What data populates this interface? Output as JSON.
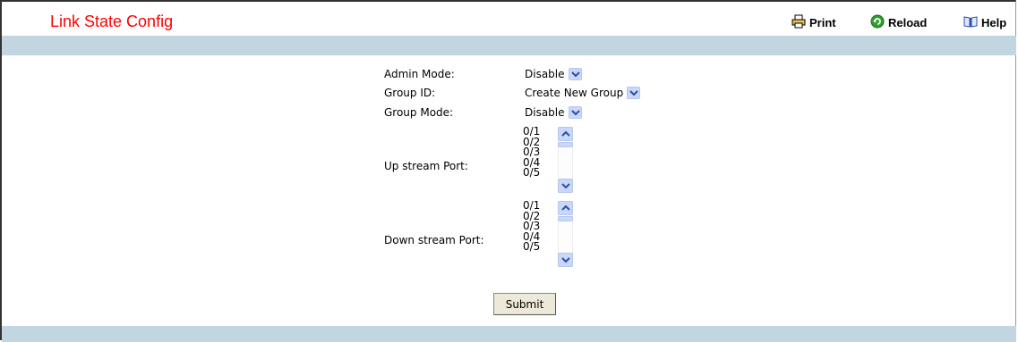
{
  "page": {
    "title": "Link State Config"
  },
  "toolbar": {
    "print_label": "Print",
    "reload_label": "Reload",
    "help_label": "Help"
  },
  "form": {
    "admin_mode": {
      "label": "Admin Mode:",
      "value": "Disable"
    },
    "group_id": {
      "label": "Group ID:",
      "value": "Create New Group"
    },
    "group_mode": {
      "label": "Group Mode:",
      "value": "Disable"
    },
    "upstream_port": {
      "label": "Up stream Port:",
      "options": [
        "0/1",
        "0/2",
        "0/3",
        "0/4",
        "0/5"
      ]
    },
    "downstream_port": {
      "label": "Down stream Port:",
      "options": [
        "0/1",
        "0/2",
        "0/3",
        "0/4",
        "0/5"
      ]
    },
    "submit_label": "Submit"
  },
  "colors": {
    "title": "#ff0000",
    "band": "#c1d6e1",
    "dropdown_button": "#c9d8f8"
  },
  "icons": {
    "print": "printer-icon",
    "reload": "reload-icon",
    "help": "help-book-icon",
    "dropdown": "chevron-down-icon"
  }
}
